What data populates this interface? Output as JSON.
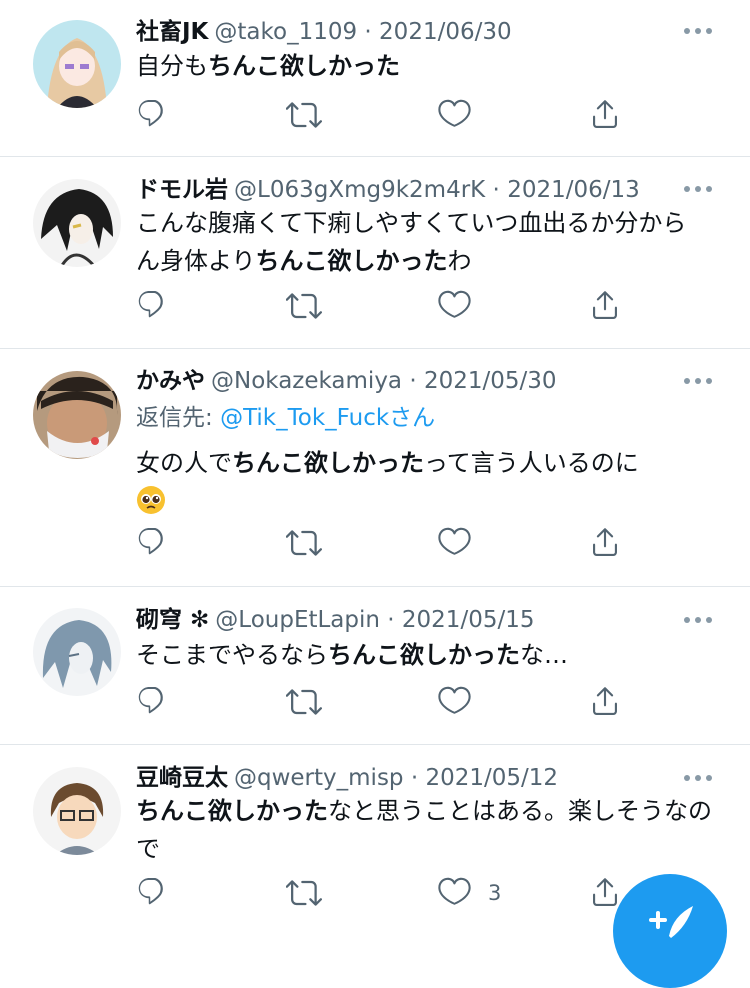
{
  "tweets": [
    {
      "name": "社畜JK",
      "handle": "@tako_1109",
      "date": "2021/06/30",
      "text_pre": "自分も",
      "text_bold": "ちんこ欲しかった",
      "text_post": "",
      "like_count": ""
    },
    {
      "name": "ドモル岩",
      "handle": "@L063gXmg9k2m4rK",
      "date": "2021/06/13",
      "text_pre": "こんな腹痛くて下痢しやすくていつ血出るか分から ん身体より",
      "text_bold": "ちんこ欲しかった",
      "text_post": "わ",
      "like_count": ""
    },
    {
      "name": "かみや",
      "handle": "@Nokazekamiya",
      "date": "2021/05/30",
      "reply_label": "返信先: ",
      "reply_target": "@Tik_Tok_Fuckさん",
      "text_pre": "女の人で",
      "text_bold": "ちんこ欲しかった",
      "text_post": "って言う人いるのに",
      "emoji": "pleading-face",
      "like_count": ""
    },
    {
      "name": "砌穹 ✻",
      "handle": "@LoupEtLapin",
      "date": "2021/05/15",
      "text_pre": "そこまでやるなら",
      "text_bold": "ちんこ欲しかった",
      "text_post": "な…",
      "like_count": ""
    },
    {
      "name": "豆崎豆太",
      "handle": "@qwerty_misp",
      "date": "2021/05/12",
      "text_pre": "",
      "text_bold": "ちんこ欲しかった",
      "text_post": "なと思うことはある。楽しそうなので",
      "like_count": "3"
    }
  ],
  "icons": {
    "reply": "reply-icon",
    "retweet": "retweet-icon",
    "like": "heart-icon",
    "share": "share-icon",
    "more": "more-icon",
    "compose": "compose-tweet-icon"
  },
  "colors": {
    "accent": "#1d9bf0",
    "secondary_text": "#536471",
    "divider": "#e1e6ea"
  }
}
